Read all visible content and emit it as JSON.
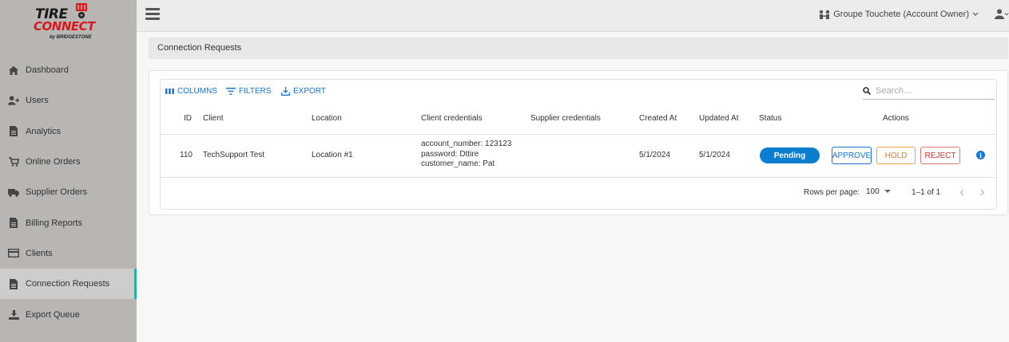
{
  "app": {
    "logo_line1": "TIRE",
    "logo_line2": "CONNECT",
    "logo_sub": "by BRIDGESTONE"
  },
  "sidebar": {
    "items": [
      {
        "label": "Dashboard",
        "icon": "home-icon"
      },
      {
        "label": "Users",
        "icon": "add-user-icon"
      },
      {
        "label": "Analytics",
        "icon": "document-icon"
      },
      {
        "label": "Online Orders",
        "icon": "cart-icon"
      },
      {
        "label": "Supplier Orders",
        "icon": "truck-icon"
      },
      {
        "label": "Billing Reports",
        "icon": "document-icon"
      },
      {
        "label": "Clients",
        "icon": "card-icon"
      },
      {
        "label": "Connection Requests",
        "icon": "document-icon",
        "active": true
      },
      {
        "label": "Export Queue",
        "icon": "download-icon"
      }
    ]
  },
  "topbar": {
    "account_label": "Groupe Touchete (Account Owner)"
  },
  "page": {
    "title": "Connection Requests"
  },
  "toolbar": {
    "columns_label": "COLUMNS",
    "filters_label": "FILTERS",
    "export_label": "EXPORT",
    "search_placeholder": "Search…"
  },
  "table": {
    "headers": {
      "id": "ID",
      "client": "Client",
      "location": "Location",
      "client_credentials": "Client credentials",
      "supplier_credentials": "Supplier credentials",
      "created_at": "Created At",
      "updated_at": "Updated At",
      "status": "Status",
      "actions": "Actions"
    },
    "rows": [
      {
        "id": "110",
        "client": "TechSupport Test",
        "location": "Location #1",
        "credentials": [
          "account_number: 123123",
          "password: Dttire",
          "customer_name: Pat"
        ],
        "supplier_credentials": "",
        "created_at": "5/1/2024",
        "updated_at": "5/1/2024",
        "status": "Pending",
        "approve_label": "APPROVE",
        "hold_label": "HOLD",
        "reject_label": "REJECT"
      }
    ]
  },
  "footer": {
    "rows_per_page_label": "Rows per page:",
    "rows_per_page_value": "100",
    "range": "1–1 of 1"
  },
  "colors": {
    "sidebar_bg": "#b8b5b2",
    "accent_blue": "#1976d2",
    "status_pending": "#0a7fd0",
    "hold_orange": "#e67e22",
    "reject_red": "#d32f2f",
    "active_indicator": "#23b3a2",
    "brand_red": "#d71920"
  }
}
